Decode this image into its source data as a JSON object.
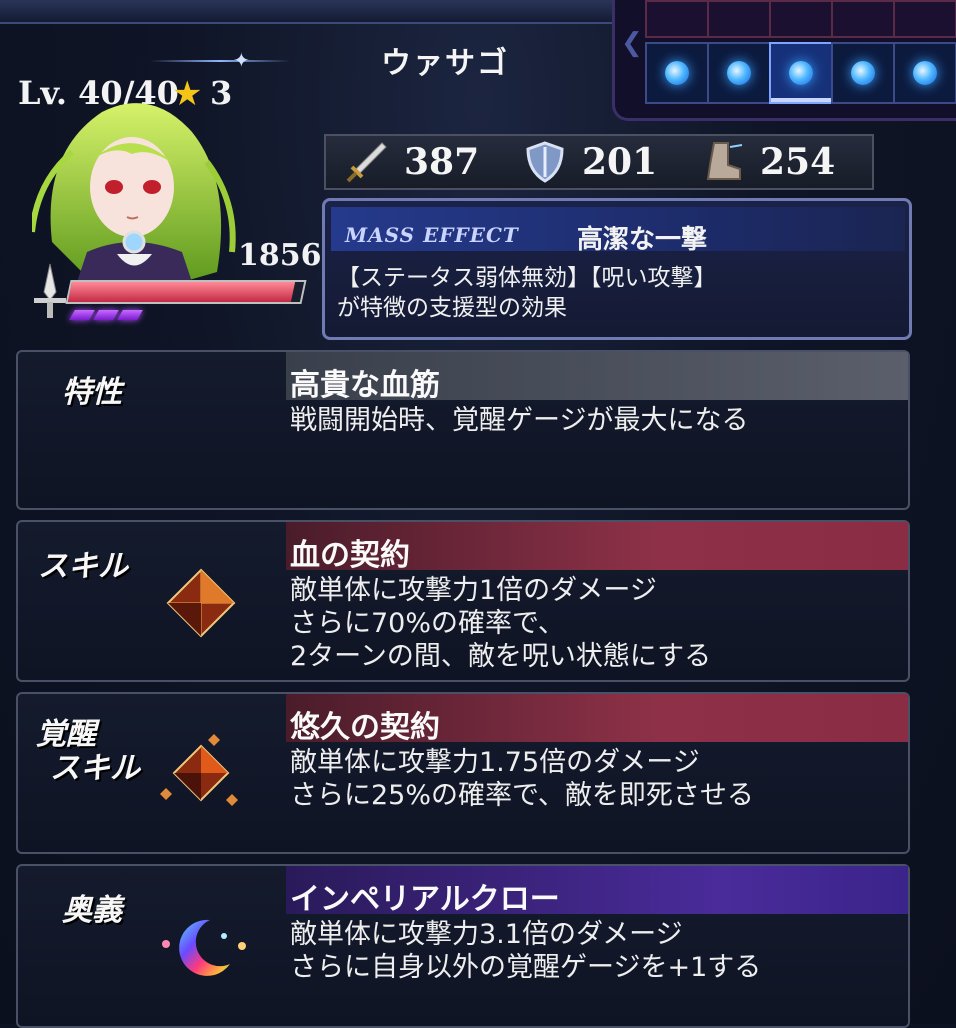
{
  "header": {
    "character_name": "ウァサゴ"
  },
  "slots": {
    "count": 5,
    "active_index": 2
  },
  "profile": {
    "level": "Lv. 40/40",
    "rarity": "3",
    "hp": "1856"
  },
  "stats": {
    "attack": "387",
    "defense": "201",
    "speed": "254"
  },
  "mass_effect": {
    "label": "MASS EFFECT",
    "name": "高潔な一撃",
    "desc_line1": "【ステータス弱体無効】【呪い攻撃】",
    "desc_line2": "が特徴の支援型の効果"
  },
  "trait": {
    "label": "特性",
    "title": "高貴な血筋",
    "desc": [
      "戦闘開始時、覚醒ゲージが最大になる"
    ]
  },
  "skill": {
    "label": "スキル",
    "title": "血の契約",
    "desc": [
      "敵単体に攻撃力1倍のダメージ",
      "さらに70%の確率で、",
      "2ターンの間、敵を呪い状態にする"
    ]
  },
  "awaken_skill": {
    "label_line1": "覚醒",
    "label_line2": "スキル",
    "title": "悠久の契約",
    "desc": [
      "敵単体に攻撃力1.75倍のダメージ",
      "さらに25%の確率で、敵を即死させる"
    ]
  },
  "ultimate": {
    "label": "奥義",
    "title": "インペリアルクロー",
    "desc": [
      "敵単体に攻撃力3.1倍のダメージ",
      "さらに自身以外の覚醒ゲージを+1する"
    ]
  },
  "icons": {
    "star": "star-icon",
    "attack": "sword-icon",
    "defense": "shield-icon",
    "speed": "boot-icon",
    "weapon": "sword-class-icon",
    "skill": "red-crystal-icon",
    "ultimate": "rainbow-crescent-icon"
  }
}
